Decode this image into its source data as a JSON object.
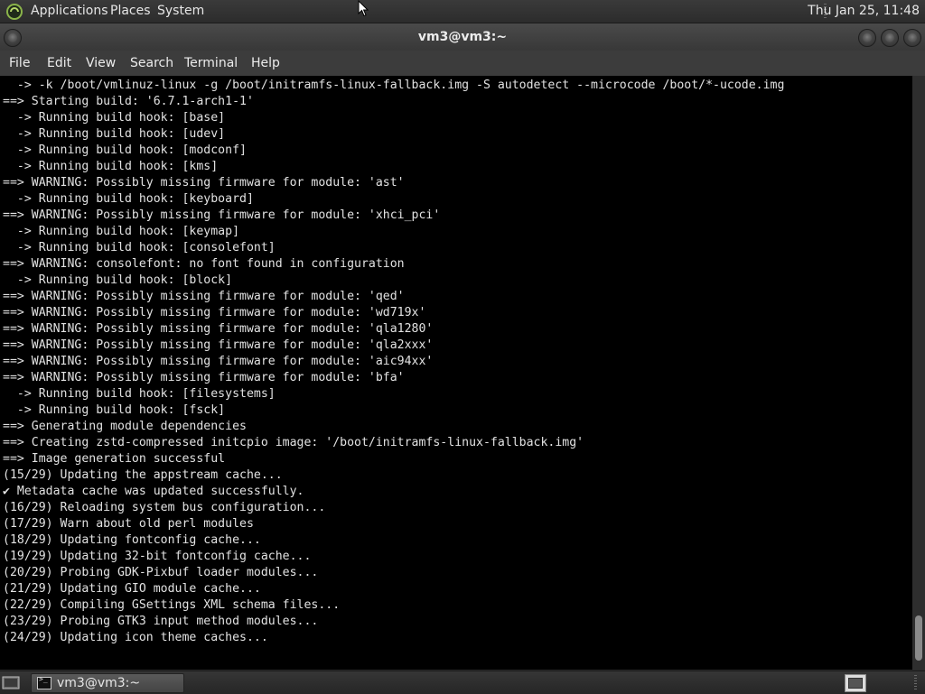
{
  "top_panel": {
    "menus": [
      "Applications",
      "Places",
      "System"
    ],
    "clock": "Thu Jan 25, 11:48",
    "distro_icon": "distro-logo-icon"
  },
  "window": {
    "title": "vm3@vm3:~",
    "menu": [
      "File",
      "Edit",
      "View",
      "Search",
      "Terminal",
      "Help"
    ]
  },
  "terminal": {
    "lines": [
      "  -> -k /boot/vmlinuz-linux -g /boot/initramfs-linux-fallback.img -S autodetect --microcode /boot/*-ucode.img",
      "==> Starting build: '6.7.1-arch1-1'",
      "  -> Running build hook: [base]",
      "  -> Running build hook: [udev]",
      "  -> Running build hook: [modconf]",
      "  -> Running build hook: [kms]",
      "==> WARNING: Possibly missing firmware for module: 'ast'",
      "  -> Running build hook: [keyboard]",
      "==> WARNING: Possibly missing firmware for module: 'xhci_pci'",
      "  -> Running build hook: [keymap]",
      "  -> Running build hook: [consolefont]",
      "==> WARNING: consolefont: no font found in configuration",
      "  -> Running build hook: [block]",
      "==> WARNING: Possibly missing firmware for module: 'qed'",
      "==> WARNING: Possibly missing firmware for module: 'wd719x'",
      "==> WARNING: Possibly missing firmware for module: 'qla1280'",
      "==> WARNING: Possibly missing firmware for module: 'qla2xxx'",
      "==> WARNING: Possibly missing firmware for module: 'aic94xx'",
      "==> WARNING: Possibly missing firmware for module: 'bfa'",
      "  -> Running build hook: [filesystems]",
      "  -> Running build hook: [fsck]",
      "==> Generating module dependencies",
      "==> Creating zstd-compressed initcpio image: '/boot/initramfs-linux-fallback.img'",
      "==> Image generation successful",
      "(15/29) Updating the appstream cache...",
      "✔ Metadata cache was updated successfully.",
      "(16/29) Reloading system bus configuration...",
      "(17/29) Warn about old perl modules",
      "(18/29) Updating fontconfig cache...",
      "(19/29) Updating 32-bit fontconfig cache...",
      "(20/29) Probing GDK-Pixbuf loader modules...",
      "(21/29) Updating GIO module cache...",
      "(22/29) Compiling GSettings XML schema files...",
      "(23/29) Probing GTK3 input method modules...",
      "(24/29) Updating icon theme caches..."
    ]
  },
  "taskbar": {
    "task_label": "vm3@vm3:~"
  }
}
